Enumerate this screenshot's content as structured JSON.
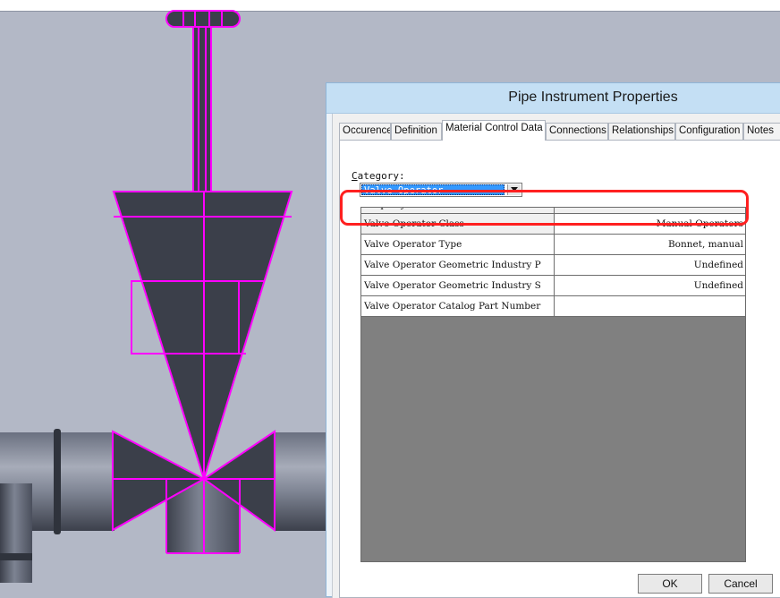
{
  "dialog": {
    "title": "Pipe Instrument Properties",
    "tabs": [
      {
        "label": "Occurence",
        "active": false
      },
      {
        "label": "Definition",
        "active": false
      },
      {
        "label": "Material Control Data",
        "active": true
      },
      {
        "label": "Connections",
        "active": false
      },
      {
        "label": "Relationships",
        "active": false
      },
      {
        "label": "Configuration",
        "active": false
      },
      {
        "label": "Notes",
        "active": false
      }
    ],
    "category_label": "Category:",
    "category_value": "Valve Operator",
    "grid": {
      "header": {
        "property": "Property",
        "value": "Value"
      },
      "rows": [
        {
          "property": "Valve Operator Class",
          "value": "Manual Operators"
        },
        {
          "property": "Valve Operator Type",
          "value": "Bonnet, manual"
        },
        {
          "property": "Valve Operator Geometric Industry P",
          "value": "Undefined"
        },
        {
          "property": "Valve Operator Geometric Industry S",
          "value": "Undefined"
        },
        {
          "property": "Valve Operator Catalog Part Number",
          "value": ""
        }
      ]
    },
    "buttons": {
      "ok": "OK",
      "cancel": "Cancel"
    }
  },
  "colors": {
    "highlight": "#ff2020",
    "cad_wireframe": "#ff00ff",
    "cad_body": "#3b3f4a",
    "viewport_bg": "#b3b8c6",
    "titlebar": "#c4dff4"
  }
}
